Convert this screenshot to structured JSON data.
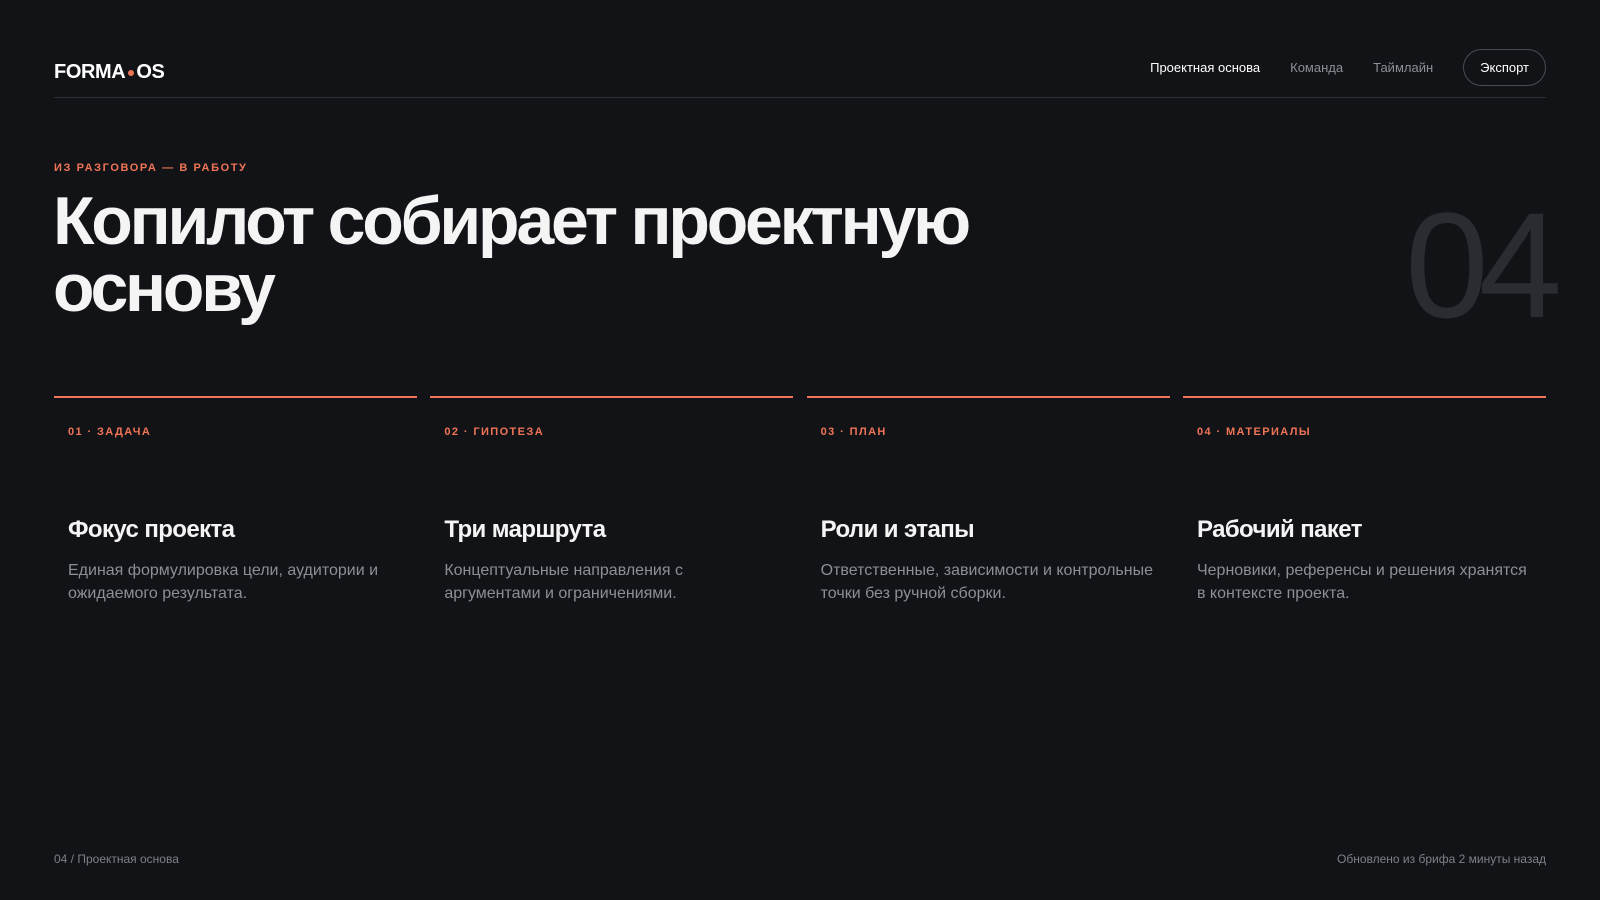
{
  "header": {
    "logo_left": "FORMA",
    "logo_right": "OS",
    "nav": [
      {
        "label": "Проектная основа",
        "active": true
      },
      {
        "label": "Команда",
        "active": false
      },
      {
        "label": "Таймлайн",
        "active": false
      }
    ],
    "export_label": "Экспорт"
  },
  "hero": {
    "eyebrow": "ИЗ РАЗГОВОРА — В РАБОТУ",
    "title": "Копилот собирает проектную основу",
    "slide_number": "04"
  },
  "cards": [
    {
      "tag": "01 · ЗАДАЧА",
      "title": "Фокус проекта",
      "description": "Единая формулировка цели, аудитории и ожидаемого результата."
    },
    {
      "tag": "02 · ГИПОТЕЗА",
      "title": "Три маршрута",
      "description": "Концептуальные направления с аргументами и ограничениями."
    },
    {
      "tag": "03 · ПЛАН",
      "title": "Роли и этапы",
      "description": "Ответственные, зависимости и контрольные точки без ручной сборки."
    },
    {
      "tag": "04 · МАТЕРИАЛЫ",
      "title": "Рабочий пакет",
      "description": "Черновики, референсы и решения хранятся в контексте проекта."
    }
  ],
  "footer": {
    "breadcrumb": "04 / Проектная основа",
    "status": "Обновлено из брифа 2 минуты назад"
  },
  "colors": {
    "background": "#121317",
    "accent": "#f07456",
    "text": "#f4f4f4",
    "muted": "#8c8f96"
  }
}
